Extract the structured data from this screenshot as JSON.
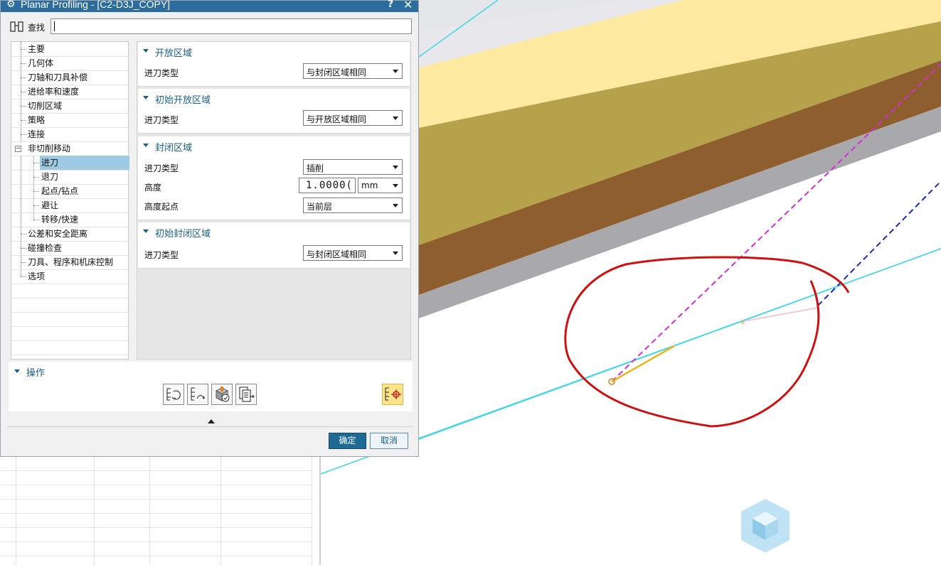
{
  "window": {
    "title": "Planar Profiling - [C2-D3J_COPY]",
    "help": "?",
    "close": "✕"
  },
  "search": {
    "label": "查找",
    "value": ""
  },
  "tree": {
    "items": [
      {
        "label": "主要"
      },
      {
        "label": "几何体"
      },
      {
        "label": "刀轴和刀具补偿"
      },
      {
        "label": "进给率和速度"
      },
      {
        "label": "切削区域"
      },
      {
        "label": "策略"
      },
      {
        "label": "连接"
      },
      {
        "label": "非切削移动"
      },
      {
        "label": "进刀",
        "selected": true
      },
      {
        "label": "退刀"
      },
      {
        "label": "起点/钻点"
      },
      {
        "label": "避让"
      },
      {
        "label": "转移/快速"
      },
      {
        "label": "公差和安全距离"
      },
      {
        "label": "碰撞检查"
      },
      {
        "label": "刀具、程序和机床控制"
      },
      {
        "label": "选项"
      }
    ]
  },
  "groups": {
    "open_area": {
      "title": "开放区域",
      "type_label": "进刀类型",
      "type_value": "与封闭区域相同"
    },
    "initial_open": {
      "title": "初始开放区域",
      "type_label": "进刀类型",
      "type_value": "与开放区域相同"
    },
    "closed_area": {
      "title": "封闭区域",
      "type_label": "进刀类型",
      "type_value": "插削",
      "height_label": "高度",
      "height_value": "1.0000(",
      "height_unit": "mm",
      "height_from_label": "高度起点",
      "height_from_value": "当前层"
    },
    "initial_closed": {
      "title": "初始封闭区域",
      "type_label": "进刀类型",
      "type_value": "与封闭区域相同"
    }
  },
  "operations": {
    "title": "操作",
    "buttons": [
      "generate-icon",
      "replay-icon",
      "verify-icon",
      "list-icon",
      "display-icon"
    ]
  },
  "footer": {
    "ok": "确定",
    "cancel": "取消"
  },
  "colors": {
    "titlebar": "#2b6e9e",
    "accent": "#1b5f8c",
    "selected": "#9ecbe3",
    "annotation": "#d01010"
  }
}
